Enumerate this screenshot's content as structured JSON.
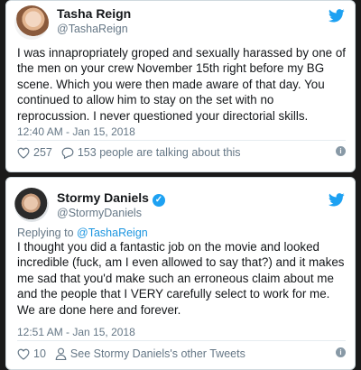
{
  "tweets": [
    {
      "name": "Tasha Reign",
      "handle": "@TashaReign",
      "text": "I was innapropriately groped and sexually harassed by one of the men on your crew November 15th right before my BG scene. Which you were then made aware of that day.  You continued to allow him to stay on the set with no reprocussion. I never questioned your directorial skills.",
      "time": "12:40 AM - Jan 15, 2018",
      "likes": "257",
      "talking": "153 people are talking about this"
    },
    {
      "name": "Stormy Daniels",
      "handle": "@StormyDaniels",
      "verified": true,
      "replying_label": "Replying to",
      "replying_handle": "@TashaReign",
      "text": "I thought you did a fantastic job on the movie and looked incredible (fuck, am I even allowed to say that?) and it makes me sad that you'd make such an erroneous claim about me and the people that I VERY carefully select to work for me. We are done here and forever.",
      "time": "12:51 AM - Jan 15, 2018",
      "likes": "10",
      "other_tweets": "See Stormy Daniels's other Tweets"
    }
  ],
  "colors": {
    "twitter_blue": "#1da1f2",
    "secondary_text": "#657786",
    "background": "#1a1a1a"
  },
  "icons": [
    "twitter-bird-icon",
    "heart-icon",
    "comment-icon",
    "person-icon",
    "info-icon",
    "verified-badge-icon"
  ]
}
